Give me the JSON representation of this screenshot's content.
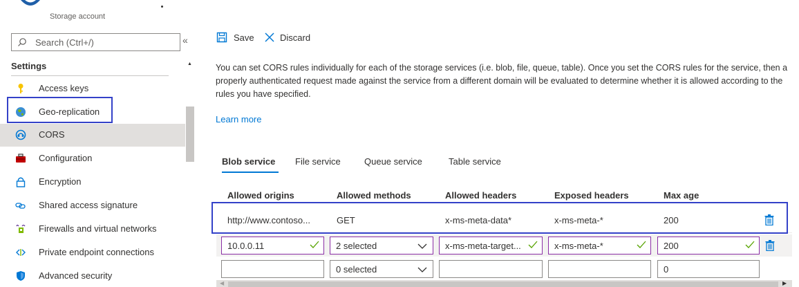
{
  "header": {
    "subtitle": "Storage account"
  },
  "sidebar": {
    "search_placeholder": "Search (Ctrl+/)",
    "collapse": "«",
    "section_title": "Settings",
    "items": [
      {
        "label": "Access keys",
        "icon": "key-icon"
      },
      {
        "label": "Geo-replication",
        "icon": "globe-icon"
      },
      {
        "label": "CORS",
        "icon": "cors-icon",
        "selected": true
      },
      {
        "label": "Configuration",
        "icon": "toolbox-icon"
      },
      {
        "label": "Encryption",
        "icon": "lock-icon"
      },
      {
        "label": "Shared access signature",
        "icon": "link-icon"
      },
      {
        "label": "Firewalls and virtual networks",
        "icon": "firewall-icon"
      },
      {
        "label": "Private endpoint connections",
        "icon": "endpoint-icon"
      },
      {
        "label": "Advanced security",
        "icon": "shield-icon"
      }
    ]
  },
  "toolbar": {
    "save": "Save",
    "discard": "Discard"
  },
  "description": "You can set CORS rules individually for each of the storage services (i.e. blob, file, queue, table). Once you set the CORS rules for the service, then a properly authenticated request made against the service from a different domain will be evaluated to determine whether it is allowed according to the rules you have specified.",
  "learn_more": "Learn more",
  "tabs": [
    {
      "label": "Blob service",
      "active": true
    },
    {
      "label": "File service"
    },
    {
      "label": "Queue service"
    },
    {
      "label": "Table service"
    }
  ],
  "table": {
    "columns": [
      "Allowed origins",
      "Allowed methods",
      "Allowed headers",
      "Exposed headers",
      "Max age"
    ],
    "saved_row": {
      "origins": "http://www.contoso...",
      "methods": "GET",
      "allowed_headers": "x-ms-meta-data*",
      "exposed_headers": "x-ms-meta-*",
      "max_age": "200"
    },
    "edit_row": {
      "origins": "10.0.0.11",
      "methods": "2 selected",
      "allowed_headers": "x-ms-meta-target...",
      "exposed_headers": "x-ms-meta-*",
      "max_age": "200"
    },
    "new_row": {
      "origins": "",
      "methods": "0 selected",
      "allowed_headers": "",
      "exposed_headers": "",
      "max_age": "0"
    }
  },
  "colors": {
    "accent": "#0078d4",
    "highlight": "#3341c8",
    "edit_border": "#8a2da5",
    "check": "#57a300"
  }
}
